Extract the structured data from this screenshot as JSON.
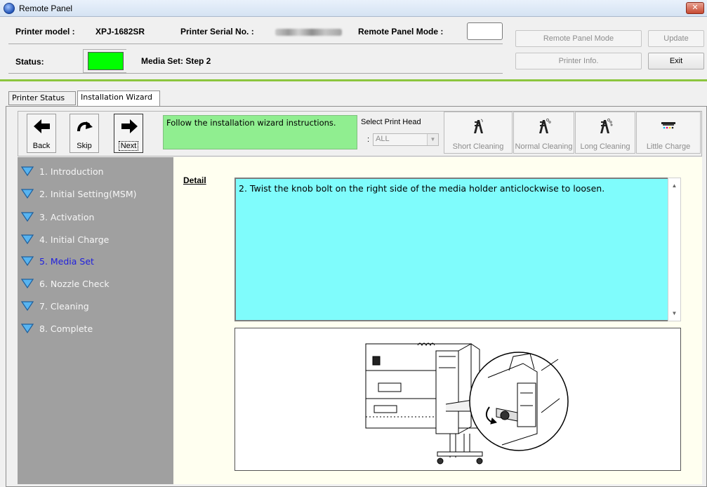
{
  "window": {
    "title": "Remote Panel",
    "close_glyph": "✕"
  },
  "header": {
    "printer_model_label": "Printer model :",
    "printer_model_value": "XPJ-1682SR",
    "serial_label": "Printer Serial No. :",
    "remote_mode_label": "Remote Panel Mode :",
    "status_label": "Status:",
    "status_color": "#00ff00",
    "status_text": "Media Set: Step 2",
    "buttons": {
      "remote_panel_mode": "Remote Panel Mode",
      "update": "Update",
      "printer_info": "Printer Info.",
      "exit": "Exit"
    }
  },
  "tabs": [
    {
      "label": "Printer Status",
      "active": false
    },
    {
      "label": "Installation Wizard",
      "active": true
    }
  ],
  "toolbar": {
    "back": "Back",
    "skip": "Skip",
    "next": "Next",
    "instruction": "Follow the installation wizard instructions.",
    "select_print_head_label": "Select Print Head",
    "select_print_head_colon": ":",
    "select_print_head_value": "ALL",
    "cleaning_buttons": {
      "short": "Short Cleaning",
      "normal": "Normal Cleaning",
      "long": "Long Cleaning",
      "little_charge": "Little Charge"
    }
  },
  "steps": [
    {
      "label": "1. Introduction",
      "current": false
    },
    {
      "label": "2. Initial Setting(MSM)",
      "current": false
    },
    {
      "label": "3. Activation",
      "current": false
    },
    {
      "label": "4. Initial Charge",
      "current": false
    },
    {
      "label": "5. Media Set",
      "current": true
    },
    {
      "label": "6. Nozzle Check",
      "current": false
    },
    {
      "label": "7. Cleaning",
      "current": false
    },
    {
      "label": "8. Complete",
      "current": false
    }
  ],
  "detail": {
    "label": "Detail",
    "text": "2. Twist the knob bolt on the right side of the media holder anticlockwise to loosen."
  },
  "colors": {
    "accent_line": "#8cc63e",
    "instruction_bg": "#90ee90",
    "detail_bg": "#7ffcfc",
    "sidebar_bg": "#a0a0a0",
    "current_step": "#2020dd"
  }
}
